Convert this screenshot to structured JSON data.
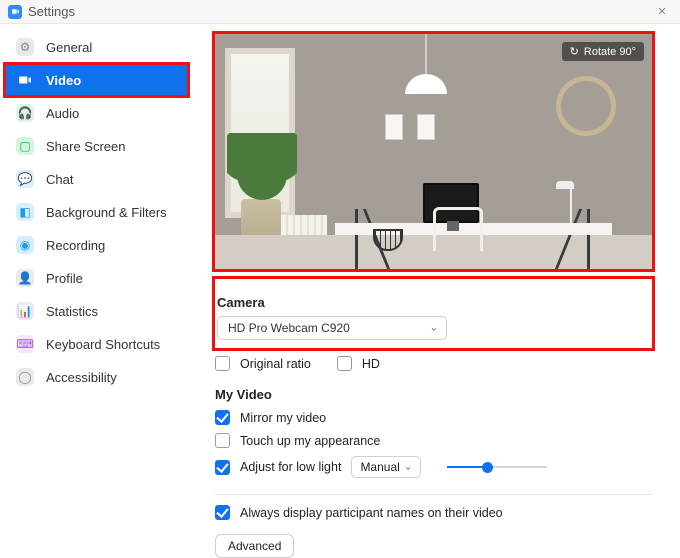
{
  "window": {
    "title": "Settings"
  },
  "sidebar": {
    "items": [
      {
        "label": "General"
      },
      {
        "label": "Video"
      },
      {
        "label": "Audio"
      },
      {
        "label": "Share Screen"
      },
      {
        "label": "Chat"
      },
      {
        "label": "Background & Filters"
      },
      {
        "label": "Recording"
      },
      {
        "label": "Profile"
      },
      {
        "label": "Statistics"
      },
      {
        "label": "Keyboard Shortcuts"
      },
      {
        "label": "Accessibility"
      }
    ],
    "active_index": 1
  },
  "preview": {
    "rotate_label": "Rotate 90°"
  },
  "camera": {
    "heading": "Camera",
    "selected": "HD Pro Webcam C920",
    "original_ratio_label": "Original ratio",
    "original_ratio_checked": false,
    "hd_label": "HD",
    "hd_checked": false
  },
  "my_video": {
    "heading": "My Video",
    "mirror_label": "Mirror my video",
    "mirror_checked": true,
    "touchup_label": "Touch up my appearance",
    "touchup_checked": false,
    "lowlight_label": "Adjust for low light",
    "lowlight_checked": true,
    "lowlight_mode": "Manual",
    "lowlight_slider_percent": 40
  },
  "always_names": {
    "label": "Always display participant names on their video",
    "checked": true
  },
  "advanced_label": "Advanced"
}
